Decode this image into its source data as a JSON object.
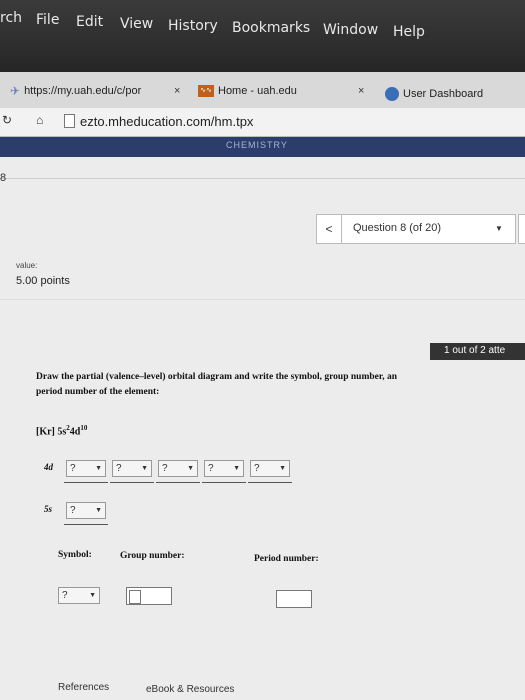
{
  "menubar": {
    "items": [
      "rch",
      "File",
      "Edit",
      "View",
      "History",
      "Bookmarks",
      "Window",
      "Help"
    ]
  },
  "tabs": [
    {
      "label": "https://my.uah.edu/c/por",
      "close": "×"
    },
    {
      "label": "Home - uah.edu",
      "close": "×"
    },
    {
      "label": "User Dashboard"
    }
  ],
  "address": {
    "url": "ezto.mheducation.com/hm.tpx"
  },
  "banner": {
    "text": "CHEMISTRY"
  },
  "sidebar": {
    "number": "8"
  },
  "question_nav": {
    "prev": "<",
    "label": "Question 8 (of 20)",
    "dropdown": "▼"
  },
  "value": {
    "label": "value:",
    "points": "5.00 points"
  },
  "attempts": {
    "text": "1 out of 2 atte"
  },
  "question": {
    "prompt_line1": "Draw the partial (valence–level) orbital diagram and write the symbol, group number, an",
    "prompt_line2": "period number of the element:",
    "config_prefix": "[Kr] 5s",
    "config_s_exp": "2",
    "config_d": "4d",
    "config_d_exp": "10"
  },
  "orbitals": {
    "d_label": "4d",
    "s_label": "5s",
    "placeholder": "?",
    "arrow": "▼"
  },
  "answers": {
    "symbol_label": "Symbol:",
    "group_label": "Group number:",
    "period_label": "Period number:",
    "symbol_placeholder": "?"
  },
  "footer": {
    "references": "References",
    "ebook": "eBook & Resources"
  }
}
